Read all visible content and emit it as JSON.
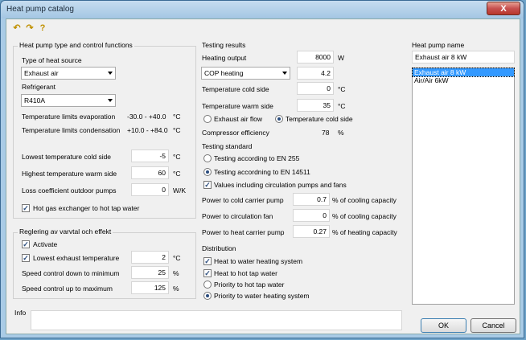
{
  "window": {
    "title": "Heat pump catalog",
    "close_glyph": "X"
  },
  "toolbar": {
    "icons": [
      "undo-icon",
      "redo-icon",
      "help-icon"
    ]
  },
  "left": {
    "group_title": "Heat pump type and control functions",
    "source_label": "Type of heat source",
    "source_value": "Exhaust air",
    "refrigerant_label": "Refrigerant",
    "refrigerant_value": "R410A",
    "evap_label": "Temperature limits evaporation",
    "evap_value": "-30.0 - +40.0",
    "evap_unit": "°C",
    "cond_label": "Temperature limits condensation",
    "cond_value": "+10.0 - +84.0",
    "cond_unit": "°C",
    "lowest_cold_label": "Lowest temperature cold side",
    "lowest_cold_value": "-5",
    "lowest_cold_unit": "°C",
    "highest_warm_label": "Highest temperature warm side",
    "highest_warm_value": "60",
    "highest_warm_unit": "°C",
    "loss_label": "Loss coefficient outdoor pumps",
    "loss_value": "0",
    "loss_unit": "W/K",
    "hotgas_label": "Hot gas exchanger to hot tap water",
    "hotgas_checked": true
  },
  "regulation": {
    "group_title": "Reglering av varvtal och effekt",
    "activate_label": "Activate",
    "activate_checked": true,
    "lowest_exhaust_label": "Lowest exhaust temperature",
    "lowest_exhaust_checked": true,
    "lowest_exhaust_value": "2",
    "lowest_exhaust_unit": "°C",
    "down_label": "Speed control down to minimum",
    "down_value": "25",
    "down_unit": "%",
    "up_label": "Speed control up to maximum",
    "up_value": "125",
    "up_unit": "%"
  },
  "testing_results": {
    "group_title": "Testing results",
    "heating_output_label": "Heating output",
    "heating_output_value": "8000",
    "heating_output_unit": "W",
    "cop_select": "COP heating",
    "cop_value": "4.2",
    "cold_side_label": "Temperature cold side",
    "cold_side_value": "0",
    "cold_side_unit": "°C",
    "warm_side_label": "Temperature warm side",
    "warm_side_value": "35",
    "warm_side_unit": "°C",
    "radio_exhaust": "Exhaust air flow",
    "radio_cold": "Temperature cold side",
    "selected": "cold",
    "compressor_label": "Compressor efficiency",
    "compressor_value": "78",
    "compressor_unit": "%"
  },
  "testing_standard": {
    "group_title": "Testing standard",
    "en255": "Testing according to EN 255",
    "en14511": "Testing accordning to EN 14511",
    "selected": "en14511",
    "values_incl_label": "Values including circulation pumps and fans",
    "values_incl_checked": true,
    "cold_pump_label": "Power to cold carrier pump",
    "cold_pump_value": "0.7",
    "cold_pump_unit": "% of cooling capacity",
    "fan_label": "Power to circulation fan",
    "fan_value": "0",
    "fan_unit": "% of cooling capacity",
    "heat_pump_label": "Power to heat carrier pump",
    "heat_pump_value": "0.27",
    "heat_pump_unit": "% of heating capacity"
  },
  "distribution": {
    "group_title": "Distribution",
    "water_heating_label": "Heat to water heating system",
    "water_heating_checked": true,
    "hot_tap_label": "Heat to hot tap water",
    "hot_tap_checked": true,
    "priority_hot_tap": "Priority to hot tap water",
    "priority_water": "Priority to water heating system",
    "selected": "priority_water"
  },
  "name_panel": {
    "label": "Heat pump name",
    "value": "Exhaust air 8 kW",
    "list": [
      "Exhaust air 8 kW",
      "Air/Air 6kW"
    ],
    "selected_index": 0
  },
  "info": {
    "label": "Info",
    "value": ""
  },
  "buttons": {
    "ok": "OK",
    "cancel": "Cancel"
  }
}
